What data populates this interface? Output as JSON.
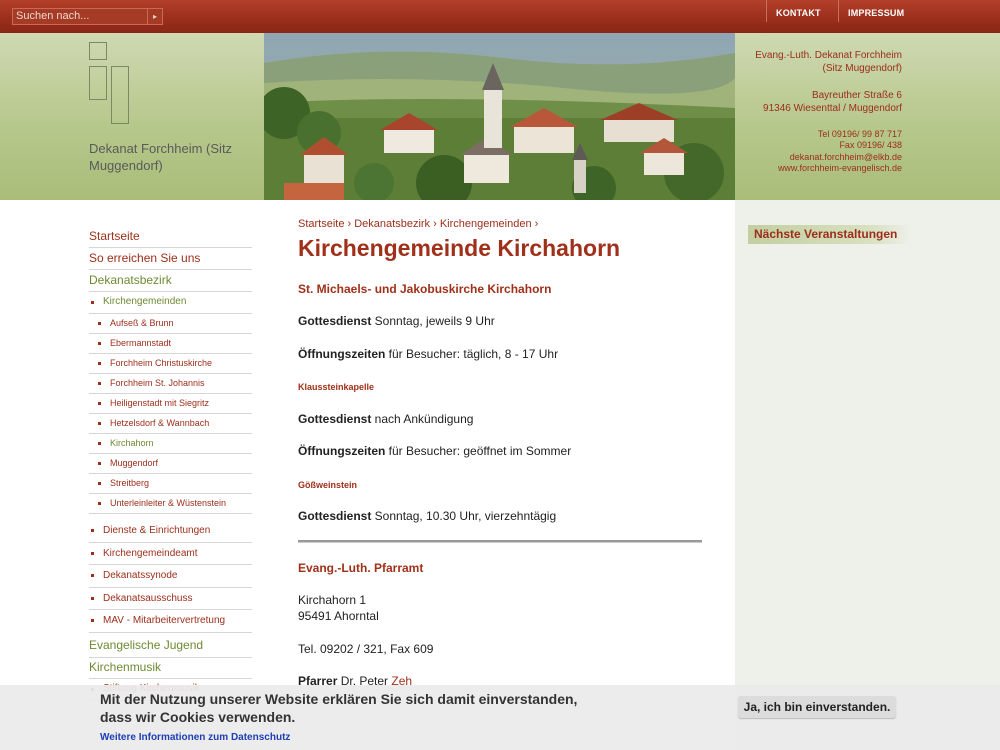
{
  "topbar": {
    "search_placeholder": "Suchen nach...",
    "search_button": "▸",
    "links": [
      "KONTAKT",
      "IMPRESSUM"
    ]
  },
  "header": {
    "site_name": "Dekanat Forchheim (Sitz Muggendorf)",
    "contact": {
      "org_line1": "Evang.-Luth. Dekanat Forchheim",
      "org_line2": "(Sitz Muggendorf)",
      "street": "Bayreuther Straße 6",
      "city": "91346 Wiesenttal / Muggendorf",
      "tel": "Tel 09196/ 99 87 717",
      "fax": "Fax 09196/ 438",
      "email": "dekanat.forchheim@elkb.de",
      "web": "www.forchheim-evangelisch.de"
    }
  },
  "nav": {
    "top": [
      "Startseite",
      "So erreichen Sie uns",
      "Dekanatsbezirk"
    ],
    "kirchengemeinden_label": "Kirchengemeinden",
    "gemeinden": [
      "Aufseß & Brunn",
      "Ebermannstadt",
      "Forchheim Christuskirche",
      "Forchheim St. Johannis",
      "Heiligenstadt mit Siegritz",
      "Hetzelsdorf & Wannbach",
      "Kirchahorn",
      "Muggendorf",
      "Streitberg",
      "Unterleinleiter & Wüstenstein"
    ],
    "more": [
      "Dienste & Einrichtungen",
      "Kirchengemeindeamt",
      "Dekanatssynode",
      "Dekanatsausschuss",
      "MAV - Mitarbeitervertretung"
    ],
    "bottom": [
      "Evangelische Jugend",
      "Kirchenmusik"
    ],
    "bottom_sub": "Stiftung Kirchenmusik"
  },
  "main": {
    "breadcrumb": "Startseite › Dekanatsbezirk › Kirchengemeinden ›",
    "title": "Kirchengemeinde Kirchahorn",
    "section1": "St. Michaels- und Jakobuskirche Kirchahorn",
    "s1_gd_label": "Gottesdienst",
    "s1_gd_text": " Sonntag, jeweils 9 Uhr",
    "s1_oz_label": "Öffnungszeiten",
    "s1_oz_text": " für Besucher: täglich, 8 - 17 Uhr",
    "section2": "Klaussteinkapelle",
    "s2_gd_label": "Gottesdienst",
    "s2_gd_text": " nach Ankündigung",
    "s2_oz_label": "Öffnungszeiten",
    "s2_oz_text": " für Besucher: geöffnet im Sommer",
    "section3": "Gößweinstein",
    "s3_gd_label": "Gottesdienst",
    "s3_gd_text": " Sonntag, 10.30 Uhr, vierzehntägig",
    "pfarramt_head": "Evang.-Luth. Pfarramt",
    "addr1": "Kirchahorn 1",
    "addr2": "95491 Ahorntal",
    "phone": "Tel. 09202 / 321, Fax 609",
    "pfarrer_label": "Pfarrer",
    "pfarrer_name": " Dr. Peter ",
    "pfarrer_link": "Zeh"
  },
  "sidebar": {
    "events_head": "Nächste Veranstaltungen"
  },
  "cookie": {
    "line1": "Mit der Nutzung unserer Website erklären Sie sich damit einverstanden,",
    "line2": "dass wir Cookies verwenden.",
    "link": "Weitere Informationen zum Datenschutz",
    "button": "Ja, ich bin einverstanden."
  }
}
